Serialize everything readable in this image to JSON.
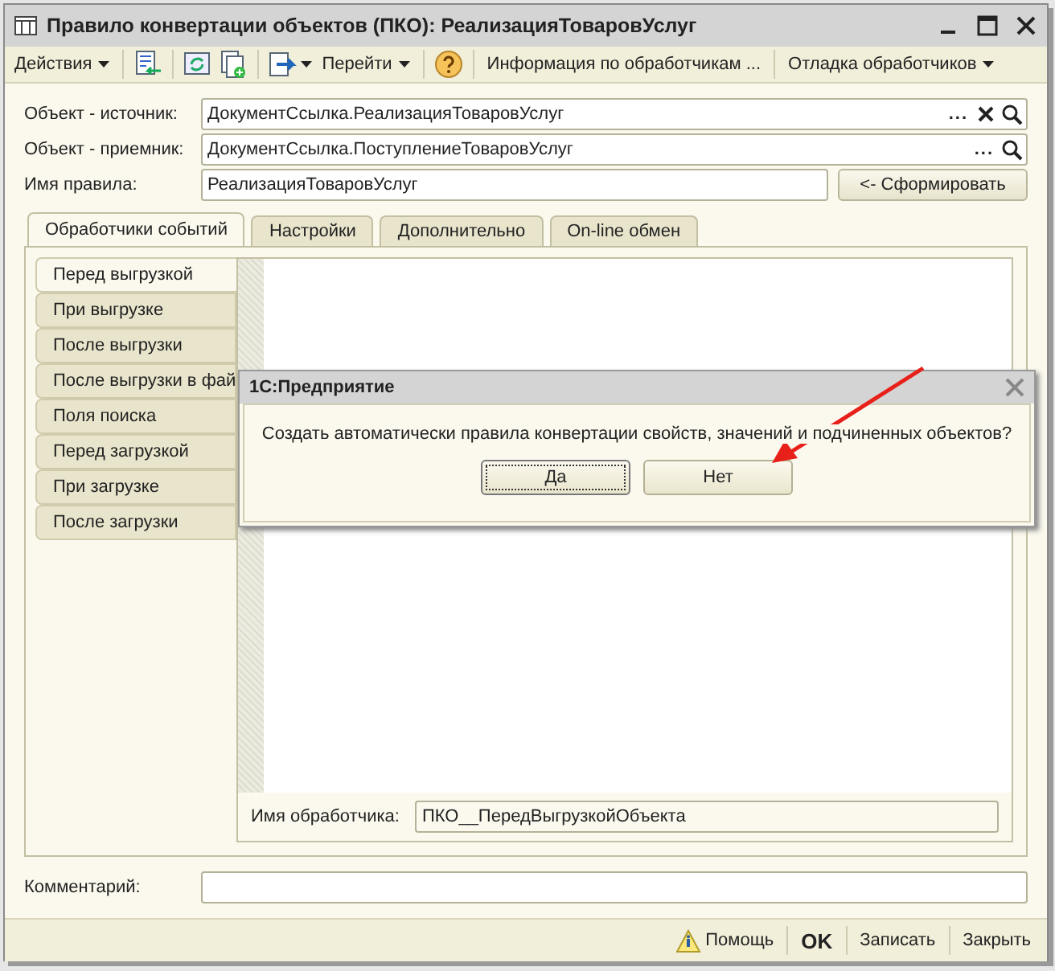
{
  "window": {
    "title": "Правило конвертации объектов (ПКО): РеализацияТоваровУслуг"
  },
  "toolbar": {
    "actions_menu": "Действия",
    "goto_menu": "Перейти",
    "info_button": "Информация по обработчикам ...",
    "debug_menu": "Отладка обработчиков"
  },
  "fields": [
    {
      "label": "Объект - источник:",
      "value": "ДокументСсылка.РеализацияТоваровУслуг",
      "select_button": "...",
      "clearable": true
    },
    {
      "label": "Объект - приемник:",
      "value": "ДокументСсылка.ПоступлениеТоваровУслуг",
      "select_button": "...",
      "clearable": false
    }
  ],
  "rule_name": {
    "label": "Имя правила:",
    "value": "РеализацияТоваровУслуг",
    "button": "<- Сформировать"
  },
  "tabs": [
    {
      "label": "Обработчики событий",
      "selected": true
    },
    {
      "label": "Настройки",
      "selected": false
    },
    {
      "label": "Дополнительно",
      "selected": false
    },
    {
      "label": "On-line обмен",
      "selected": false
    }
  ],
  "events": [
    {
      "label": "Перед выгрузкой",
      "selected": true
    },
    {
      "label": "При выгрузке",
      "selected": false
    },
    {
      "label": "После выгрузки",
      "selected": false
    },
    {
      "label": "После выгрузки в фай",
      "selected": false
    },
    {
      "label": "Поля поиска",
      "selected": false
    },
    {
      "label": "Перед загрузкой",
      "selected": false
    },
    {
      "label": "При загрузке",
      "selected": false
    },
    {
      "label": "После загрузки",
      "selected": false
    }
  ],
  "handler_name": {
    "label": "Имя обработчика:",
    "value": "ПКО__ПередВыгрузкойОбъекта"
  },
  "comment": {
    "label": "Комментарий:"
  },
  "footer": {
    "help": "Помощь",
    "ok": "OK",
    "save": "Записать",
    "close": "Закрыть"
  },
  "dialog": {
    "title": "1С:Предприятие",
    "message": "Создать автоматически правила конвертации свойств, значений и подчиненных объектов?",
    "buttons": [
      {
        "label": "Да",
        "selected": true
      },
      {
        "label": "Нет",
        "selected": false
      }
    ]
  }
}
